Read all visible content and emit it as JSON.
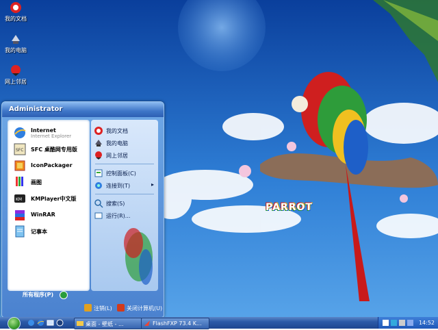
{
  "desktop": {
    "icons": [
      {
        "label": "我的文档",
        "icon": "my-documents-icon"
      },
      {
        "label": "我的电脑",
        "icon": "my-computer-icon"
      },
      {
        "label": "网上邻居",
        "icon": "network-places-icon"
      }
    ],
    "wallpaper_text": "PARROT"
  },
  "start_menu": {
    "user": "Administrator",
    "programs": [
      {
        "name": "Internet",
        "subtitle": "Internet Explorer",
        "icon": "internet-explorer-icon"
      },
      {
        "name": "SFC 桌酷网专用版",
        "icon": "sfc-icon"
      },
      {
        "name": "IconPackager",
        "icon": "iconpackager-icon"
      },
      {
        "name": "画图",
        "icon": "paint-icon"
      },
      {
        "name": "KMPlayer中文版",
        "icon": "kmplayer-icon"
      },
      {
        "name": "WinRAR",
        "icon": "winrar-icon"
      },
      {
        "name": "记事本",
        "icon": "notepad-icon"
      }
    ],
    "all_programs": "所有程序(P)",
    "places": [
      {
        "label": "我的文档",
        "icon": "my-documents-icon"
      },
      {
        "label": "我的电脑",
        "icon": "my-computer-icon"
      },
      {
        "label": "网上邻居",
        "icon": "network-places-icon"
      },
      {
        "label": "控制面板(C)",
        "icon": "control-panel-icon"
      },
      {
        "label": "连接到(T)",
        "icon": "connect-to-icon"
      },
      {
        "label": "搜索(S)",
        "icon": "search-icon"
      },
      {
        "label": "运行(R)...",
        "icon": "run-icon"
      }
    ],
    "logoff": "注销(L)",
    "shutdown": "关闭计算机(U)"
  },
  "taskbar": {
    "tasks": [
      {
        "label": "桌面 - 壁纸 - ...",
        "icon": "folder-icon"
      },
      {
        "label": "FlashFXP 73.4 K...",
        "icon": "flashfxp-icon"
      }
    ],
    "time": "14:52"
  },
  "colors": {
    "accent": "#3f76c8",
    "taskbar": "#2c5aa8",
    "start_orb": "#3a9c2e"
  }
}
